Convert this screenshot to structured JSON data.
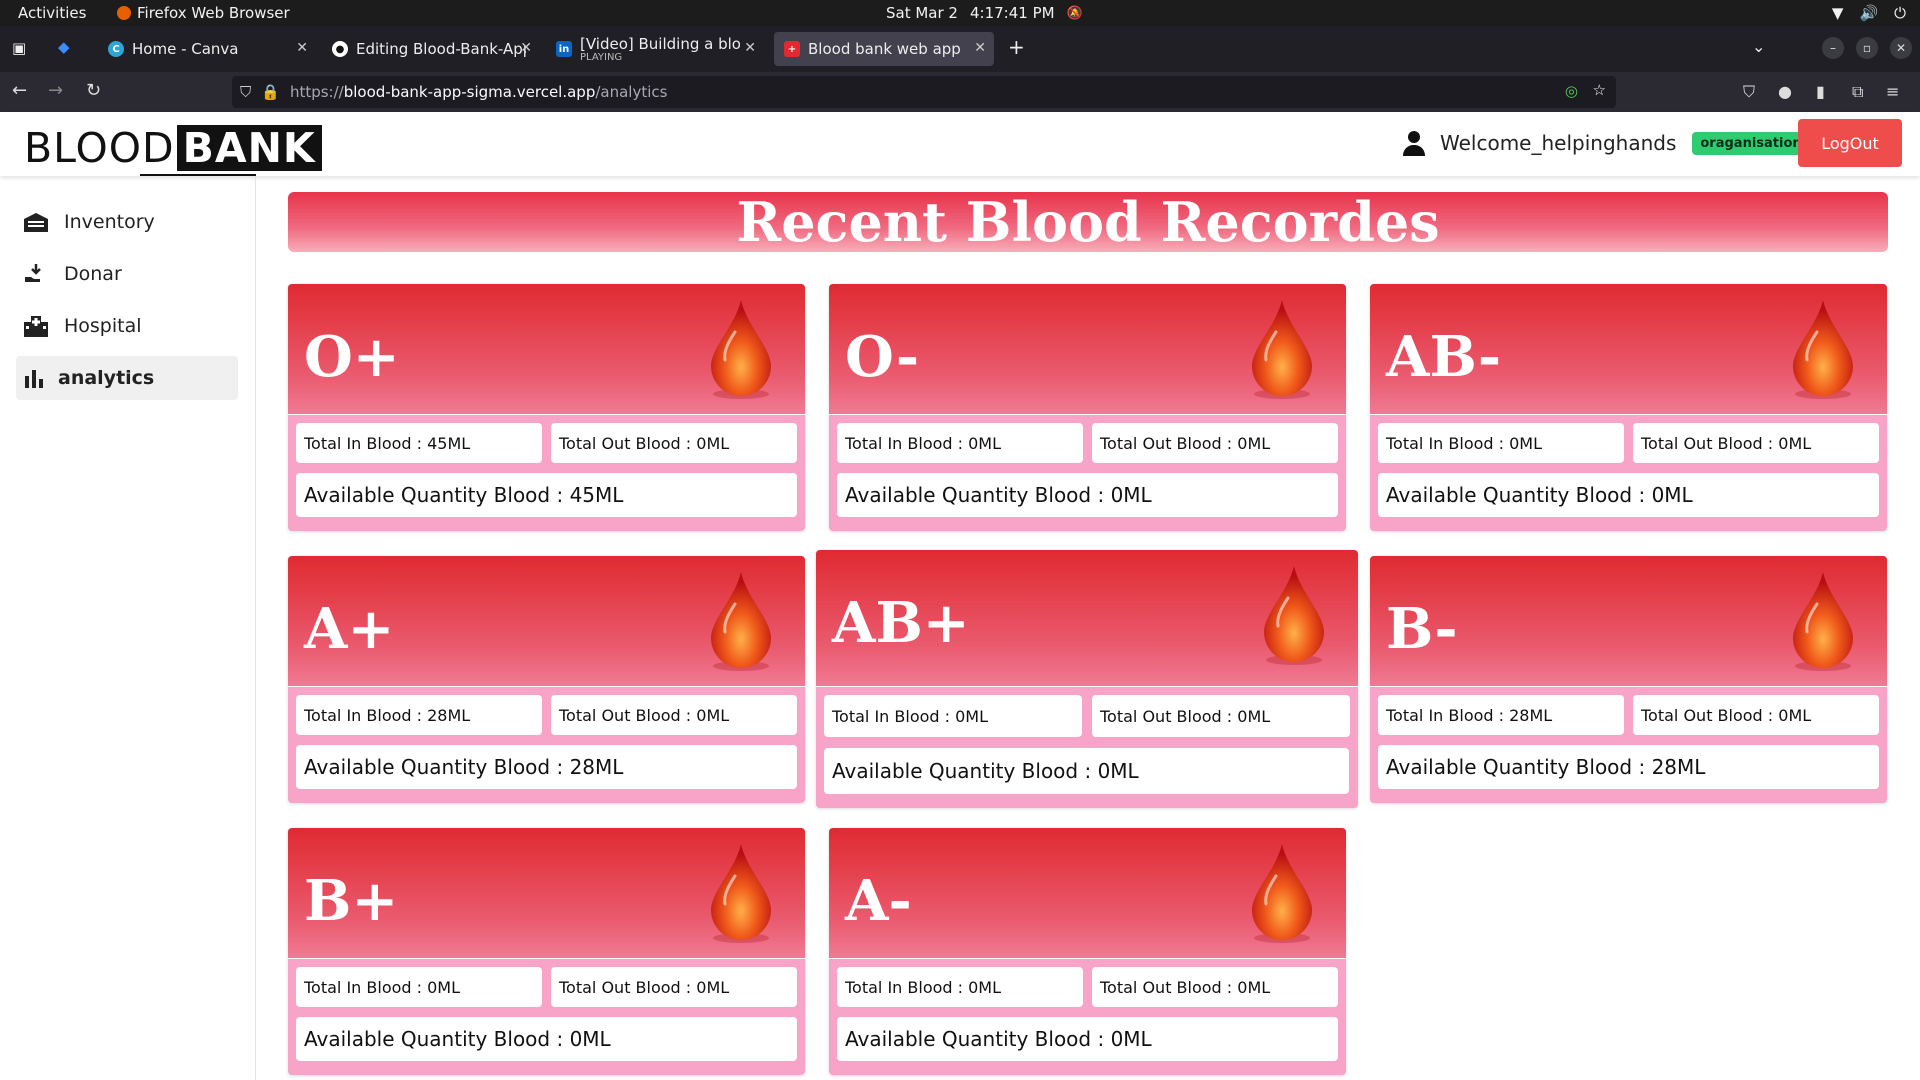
{
  "system": {
    "activities": "Activities",
    "app_name": "Firefox Web Browser",
    "date": "Sat Mar 2",
    "time": "4:17:41 PM"
  },
  "tabs": [
    {
      "label": "Home - Canva",
      "icon": "canva-icon"
    },
    {
      "label": "Editing Blood-Bank-App/",
      "icon": "github-icon"
    },
    {
      "label": "[Video] Building a blood",
      "sub": "PLAYING",
      "icon": "linkedin-icon"
    },
    {
      "label": "Blood bank web app",
      "icon": "blood-bank-favicon"
    }
  ],
  "url": {
    "protocol": "https://",
    "domain": "blood-bank-app-sigma.vercel.app",
    "path": "/analytics"
  },
  "header": {
    "logo_part1": "BLOOD",
    "logo_part2": "BANK",
    "welcome": "Welcome_helpinghands",
    "role_badge": "oraganisation",
    "logout_label": "LogOut"
  },
  "sidebar": {
    "items": [
      {
        "label": "Inventory",
        "icon": "warehouse-icon"
      },
      {
        "label": "Donar",
        "icon": "hand-holding-icon"
      },
      {
        "label": "Hospital",
        "icon": "hospital-icon"
      },
      {
        "label": "analytics",
        "icon": "bar-chart-icon",
        "active": true
      }
    ]
  },
  "banner_title": "Recent Blood Recordes",
  "cards": [
    {
      "group": "O+",
      "in": "Total In Blood : 45ML",
      "out": "Total Out Blood : 0ML",
      "available": "Available Quantity Blood : 45ML"
    },
    {
      "group": "O-",
      "in": "Total In Blood : 0ML",
      "out": "Total Out Blood : 0ML",
      "available": "Available Quantity Blood : 0ML"
    },
    {
      "group": "AB-",
      "in": "Total In Blood : 0ML",
      "out": "Total Out Blood : 0ML",
      "available": "Available Quantity Blood : 0ML"
    },
    {
      "group": "A+",
      "in": "Total In Blood : 28ML",
      "out": "Total Out Blood : 0ML",
      "available": "Available Quantity Blood : 28ML"
    },
    {
      "group": "AB+",
      "in": "Total In Blood : 0ML",
      "out": "Total Out Blood : 0ML",
      "available": "Available Quantity Blood : 0ML"
    },
    {
      "group": "B-",
      "in": "Total In Blood : 28ML",
      "out": "Total Out Blood : 0ML",
      "available": "Available Quantity Blood : 28ML"
    },
    {
      "group": "B+",
      "in": "Total In Blood : 0ML",
      "out": "Total Out Blood : 0ML",
      "available": "Available Quantity Blood : 0ML"
    },
    {
      "group": "A-",
      "in": "Total In Blood : 0ML",
      "out": "Total Out Blood : 0ML",
      "available": "Available Quantity Blood : 0ML"
    }
  ],
  "colors": {
    "accent_red": "#e02a30",
    "card_pink": "#f8a4c9",
    "logout_red": "#ef4c4c",
    "badge_green": "#2ecc71"
  }
}
